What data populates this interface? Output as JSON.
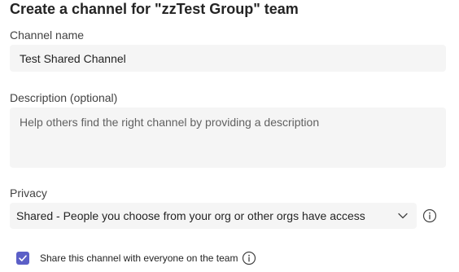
{
  "dialog": {
    "title": "Create a channel for \"zzTest Group\" team"
  },
  "channel_name": {
    "label": "Channel name",
    "value": "Test Shared Channel"
  },
  "description": {
    "label": "Description (optional)",
    "placeholder": "Help others find the right channel by providing a description",
    "value": ""
  },
  "privacy": {
    "label": "Privacy",
    "selected": "Shared - People you choose from your org or other orgs have access",
    "icons": {
      "dropdown": "chevron-down-icon",
      "info": "info-icon"
    }
  },
  "share_option": {
    "label": "Share this channel with everyone on the team",
    "checked": true,
    "icons": {
      "info": "info-icon"
    }
  },
  "colors": {
    "accent": "#5b5fc7",
    "field_background": "#f5f5f5",
    "text": "#242424",
    "placeholder": "#616161"
  }
}
